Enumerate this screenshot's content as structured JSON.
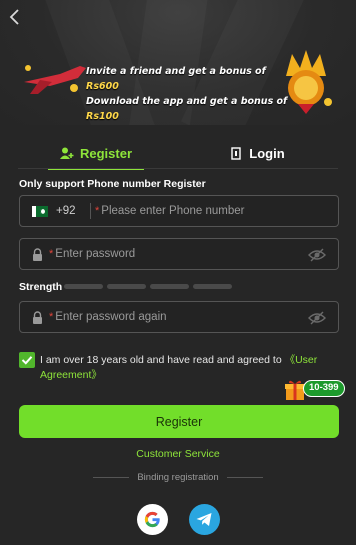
{
  "nav": {
    "back_icon": "chevron-left-icon"
  },
  "banner": {
    "line1_prefix": "Invite a friend and get a bonus of ",
    "line1_amount": "Rs600",
    "line2_prefix": "Download the app and get a bonus of ",
    "line2_amount": "Rs100"
  },
  "tabs": [
    {
      "label": "Register",
      "icon": "add-user-icon",
      "active": true
    },
    {
      "label": "Login",
      "icon": "login-icon",
      "active": false
    }
  ],
  "form": {
    "phone_note": "Only support Phone number Register",
    "country_code": "+92",
    "phone_placeholder": "Please enter Phone number",
    "password_placeholder": "Enter password",
    "strength_label": "Strength",
    "confirm_placeholder": "Enter password again",
    "required_mark": "*"
  },
  "agreement": {
    "checked": true,
    "text": "I am over 18 years old and have read and agreed to ",
    "link": "《User Agreement》"
  },
  "register_button": "Register",
  "bonus_badge": "10-399",
  "customer_service": "Customer Service",
  "binding_label": "Binding registration",
  "social": [
    {
      "icon": "google-icon"
    },
    {
      "icon": "telegram-icon"
    }
  ],
  "colors": {
    "accent": "#8ee43a",
    "button": "#72de2a",
    "background": "#262626"
  }
}
